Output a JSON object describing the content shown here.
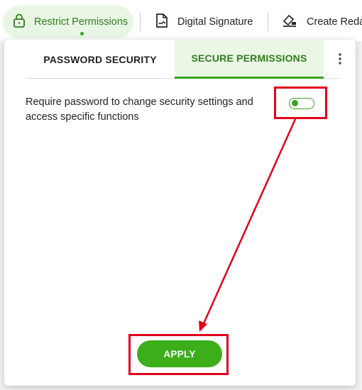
{
  "toolbar": {
    "restrict_label": "Restrict Permissions",
    "signature_label": "Digital Signature",
    "redact_label": "Create Reda"
  },
  "tabs": [
    {
      "label": "PASSWORD SECURITY",
      "active": false
    },
    {
      "label": "SECURE PERMISSIONS",
      "active": true
    }
  ],
  "setting": {
    "label": "Require password to change security settings and access specific functions",
    "toggle_on": true
  },
  "apply_label": "APPLY",
  "colors": {
    "accent": "#3cae19",
    "active_tab_bg": "#eaf7e5",
    "annotation": "#e0001a"
  }
}
